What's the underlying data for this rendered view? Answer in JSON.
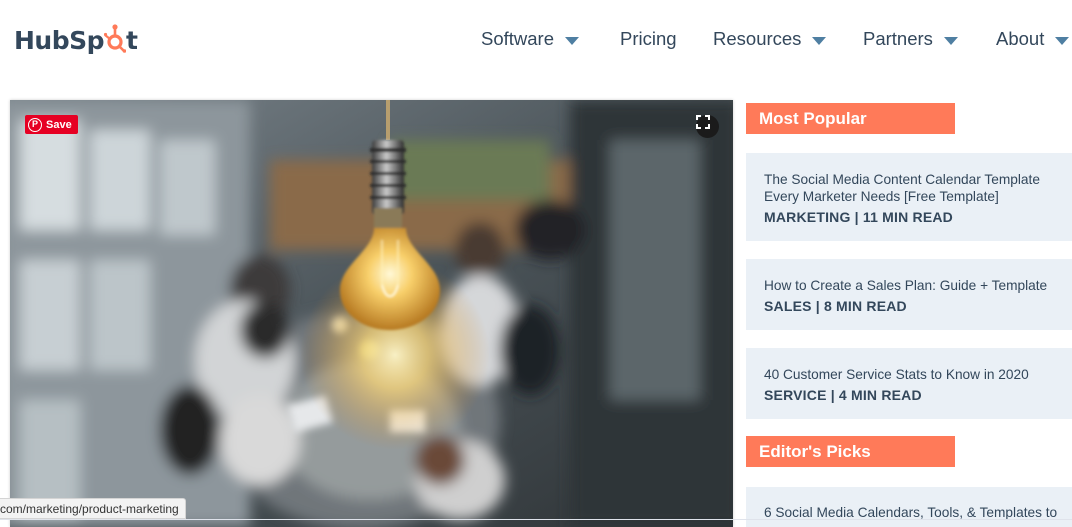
{
  "logo": {
    "text_before": "HubSp",
    "text_after": "t"
  },
  "nav": {
    "items": [
      {
        "label": "Software",
        "dropdown": true
      },
      {
        "label": "Pricing",
        "dropdown": false
      },
      {
        "label": "Resources",
        "dropdown": true
      },
      {
        "label": "Partners",
        "dropdown": true
      },
      {
        "label": "About",
        "dropdown": true
      }
    ]
  },
  "hero": {
    "save_label": "Save",
    "pin_icon": "pinterest-icon",
    "expand_icon": "expand-icon"
  },
  "sidebar": {
    "most_popular_heading": "Most Popular",
    "popular": [
      {
        "title": "The Social Media Content Calendar Template Every Marketer Needs [Free Template]",
        "meta": "MARKETING | 11 MIN READ"
      },
      {
        "title": "How to Create a Sales Plan: Guide + Template",
        "meta": "SALES | 8 MIN READ"
      },
      {
        "title": "40 Customer Service Stats to Know in 2020",
        "meta": "SERVICE | 4 MIN READ"
      }
    ],
    "editors_picks_heading": "Editor's Picks",
    "picks": [
      {
        "title": "6 Social Media Calendars, Tools, & Templates to"
      }
    ]
  },
  "status_bar": {
    "url": "com/marketing/product-marketing"
  },
  "colors": {
    "accent": "#ff7a59",
    "text": "#33475b",
    "card_bg": "#eaf0f6",
    "caret": "#4f7fa2",
    "pinterest": "#e60023"
  }
}
